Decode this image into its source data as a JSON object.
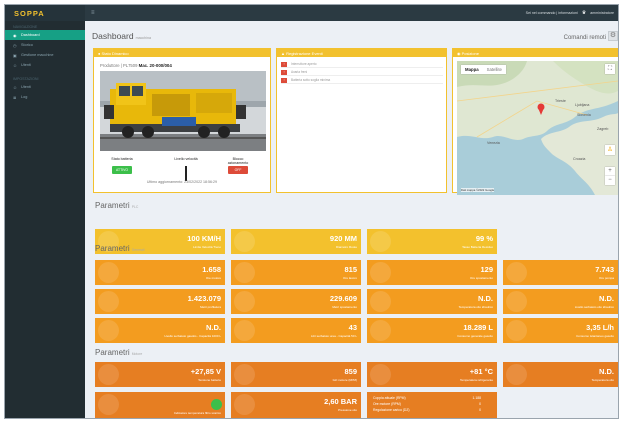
{
  "brand": "SOPPA",
  "topbar": {
    "nav_text": "Sei nel commando | informazioni",
    "user": "amministratore"
  },
  "sidebar": {
    "section1": "NAVIGAZIONE",
    "items": [
      {
        "label": "Dashboard",
        "icon": "gauge-icon",
        "active": true
      },
      {
        "label": "Storico"
      },
      {
        "label": "Gestione macchine"
      },
      {
        "label": "Utenti"
      }
    ],
    "section2": "IMPOSTAZIONI",
    "items2": [
      {
        "label": "Utenti"
      },
      {
        "label": "Log"
      }
    ]
  },
  "page": {
    "title": "Dashboard",
    "subtitle": "macchina",
    "commands": "Comandi remoti"
  },
  "machine_panel": {
    "title": "Stato Dinamico",
    "machine_prefix": "Produttore | PL7509",
    "machine_id": "Mac. 20-000/004",
    "statuses": [
      {
        "label": "Stato batteria",
        "value": "ATTIVO",
        "color": "#3cbf4a"
      },
      {
        "label": "Livello velocità"
      },
      {
        "label": "Blocco azionamento",
        "value": "OFF",
        "color": "#dd4b39"
      }
    ],
    "caption": "Ultimo aggiornamento: 23/02/2022 18:56:29"
  },
  "alarms_panel": {
    "title": "Registrazione Eventi",
    "rows": [
      {
        "badge": "!",
        "text": "Interruttore aperto"
      },
      {
        "badge": "!",
        "text": "Avaria freni"
      },
      {
        "badge": "!",
        "text": "Batteria sotto soglia minima"
      }
    ]
  },
  "map_panel": {
    "title": "Posizione",
    "tabs": [
      "Mappa",
      "Satellite"
    ],
    "labels": [
      "Venezia",
      "Trieste",
      "Croazia",
      "Slovenia",
      "Ljubljana",
      "Zagreb"
    ],
    "footer": "Dati mappa ©2022 Google"
  },
  "sections": [
    {
      "title": "Parametri",
      "subtitle": "PLC"
    },
    {
      "title": "Parametri",
      "subtitle": "Generali"
    },
    {
      "title": "Parametri",
      "subtitle": "Motore"
    }
  ],
  "tiles_row1": [
    {
      "value": "100 KM/H",
      "label": "Limite Velocità Treno"
    },
    {
      "value": "920 MM",
      "label": "Diametro Ruote"
    },
    {
      "value": "99 %",
      "label": "Tasso Batteria Residuo"
    }
  ],
  "tiles_general": [
    {
      "value": "1.658",
      "label": "Ore motore"
    },
    {
      "value": "815",
      "label": "Ore lavoro"
    },
    {
      "value": "129",
      "label": "Ore spostamento"
    },
    {
      "value": "7.743",
      "label": "Ore pompa"
    },
    {
      "value": "1.423.079",
      "label": "Metri profilatura"
    },
    {
      "value": "229.609",
      "label": "Metri spostamento"
    },
    {
      "value": "N.D.",
      "label": "Temperatura olio idraulico"
    },
    {
      "value": "N.D.",
      "label": "Livello serbatoio olio idraulico"
    },
    {
      "value": "N.D.",
      "label": "Livello serbatoio gasolio - Capacità 1000 L"
    },
    {
      "value": "43",
      "label": "Litri serbatoio urea - Capacità 50 L"
    },
    {
      "value": "18.289 L",
      "label": "Consumo generale gasolio"
    },
    {
      "value": "3,35 L/h",
      "label": "Consumo istantaneo gasolio"
    }
  ],
  "tiles_engine": [
    {
      "value": "+27,85 V",
      "label": "Tensione batterie"
    },
    {
      "value": "859",
      "label": "Giri motore (RPM)"
    },
    {
      "value": "+81 °C",
      "label": "Temperatura refrigerante"
    },
    {
      "value": "N.D.",
      "label": "Temperatura olio"
    },
    {
      "value": "",
      "label": "Indicatore temperatura filtro scarico"
    },
    {
      "value": "2,60 BAR",
      "label": "Pressione olio"
    }
  ],
  "mixed_tile": [
    {
      "label": "Coppia attuale (RPM)",
      "value": "1.188"
    },
    {
      "label": "Ore motore (RPM)",
      "value": "0"
    },
    {
      "label": "Regolazione carico (DZ)",
      "value": "0"
    }
  ]
}
